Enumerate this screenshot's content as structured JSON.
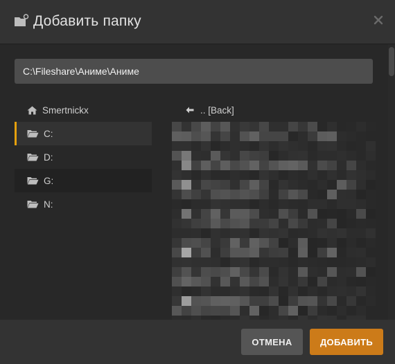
{
  "dialog": {
    "title": "Добавить папку",
    "icon": "folder-plus-icon",
    "close_icon": "close-icon"
  },
  "path_input": {
    "value": "C:\\Fileshare\\Аниме\\Аниме"
  },
  "drives": {
    "items": [
      {
        "label": "Smertnickx",
        "icon": "home-icon",
        "state": "normal"
      },
      {
        "label": "C:",
        "icon": "folder-open-icon",
        "state": "selected"
      },
      {
        "label": "D:",
        "icon": "folder-open-icon",
        "state": "normal"
      },
      {
        "label": "G:",
        "icon": "folder-open-icon",
        "state": "alt"
      },
      {
        "label": "N:",
        "icon": "folder-open-icon",
        "state": "normal"
      }
    ]
  },
  "files": {
    "back_label": ".. [Back]",
    "back_icon": "arrow-left-icon",
    "entries_obscured": true
  },
  "footer": {
    "cancel_label": "ОТМЕНА",
    "add_label": "ДОБАВИТЬ"
  },
  "colors": {
    "accent": "#e5a00d",
    "add_button": "#cc7b19",
    "cancel_button": "#555555",
    "background": "#282828",
    "header": "#333333"
  }
}
